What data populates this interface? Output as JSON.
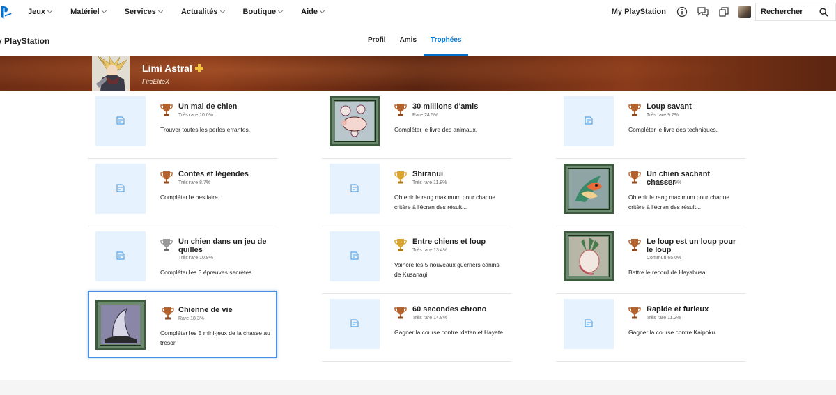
{
  "topnav": {
    "items": [
      "Jeux",
      "Matériel",
      "Services",
      "Actualités",
      "Boutique",
      "Aide"
    ],
    "my_playstation": "My PlayStation",
    "search_label": "Rechercher"
  },
  "subnav": {
    "title": "y PlayStation",
    "tabs": [
      "Profil",
      "Amis",
      "Trophées"
    ],
    "active_tab": "Trophées"
  },
  "profile": {
    "name": "Limi Astral",
    "online_id": "FireEliteX"
  },
  "colors": {
    "accent": "#0072ce",
    "bronze": "#b4632e",
    "silver": "#9a9a9a",
    "gold": "#d9a431",
    "placeholder_bg": "#e6f2fd"
  },
  "trophies": [
    {
      "title": "Un mal de chien",
      "rarity": "Très rare 10.0%",
      "desc": "Trouver toutes les perles errantes.",
      "grade": "bronze",
      "art": "placeholder"
    },
    {
      "title": "30 millions d'amis",
      "rarity": "Rare 24.5%",
      "desc": "Compléter le livre des animaux.",
      "grade": "bronze",
      "art": "boar"
    },
    {
      "title": "Loup savant",
      "rarity": "Très rare 9.7%",
      "desc": "Compléter le livre des techniques.",
      "grade": "bronze",
      "art": "placeholder"
    },
    {
      "title": "Contes et légendes",
      "rarity": "Très rare 8.7%",
      "desc": "Compléter le bestiaire.",
      "grade": "bronze",
      "art": "placeholder"
    },
    {
      "title": "Shiranui",
      "rarity": "Très rare 11.8%",
      "desc": "Obtenir le rang maximum pour chaque critère à l'écran des résult...",
      "grade": "gold",
      "art": "placeholder"
    },
    {
      "title": "Un chien sachant chasser",
      "rarity": "Commun 81.9%",
      "desc": "Obtenir le rang maximum pour chaque critère à l'écran des résult...",
      "grade": "bronze",
      "art": "fish"
    },
    {
      "title": "Un chien dans un jeu de quilles",
      "rarity": "Très rare 10.9%",
      "desc": "Compléter les 3 épreuves secrètes...",
      "grade": "silver",
      "art": "placeholder"
    },
    {
      "title": "Entre chiens et loup",
      "rarity": "Très rare 13.4%",
      "desc": "Vaincre les 5 nouveaux guerriers canins de Kusanagi.",
      "grade": "gold",
      "art": "placeholder"
    },
    {
      "title": "Le loup est un loup pour le loup",
      "rarity": "Commun 65.0%",
      "desc": "Battre le record de Hayabusa.",
      "grade": "bronze",
      "art": "radish"
    },
    {
      "title": "Chienne de vie",
      "rarity": "Rare 18.3%",
      "desc": "Compléter les 5 mini-jeux de la chasse au trésor.",
      "grade": "bronze",
      "art": "blade"
    },
    {
      "title": "60 secondes chrono",
      "rarity": "Très rare 14.8%",
      "desc": "Gagner la course contre Idaten et Hayate.",
      "grade": "bronze",
      "art": "placeholder"
    },
    {
      "title": "Rapide et furieux",
      "rarity": "Très rare 11.2%",
      "desc": "Gagner la course contre Kaipoku.",
      "grade": "bronze",
      "art": "placeholder"
    }
  ]
}
